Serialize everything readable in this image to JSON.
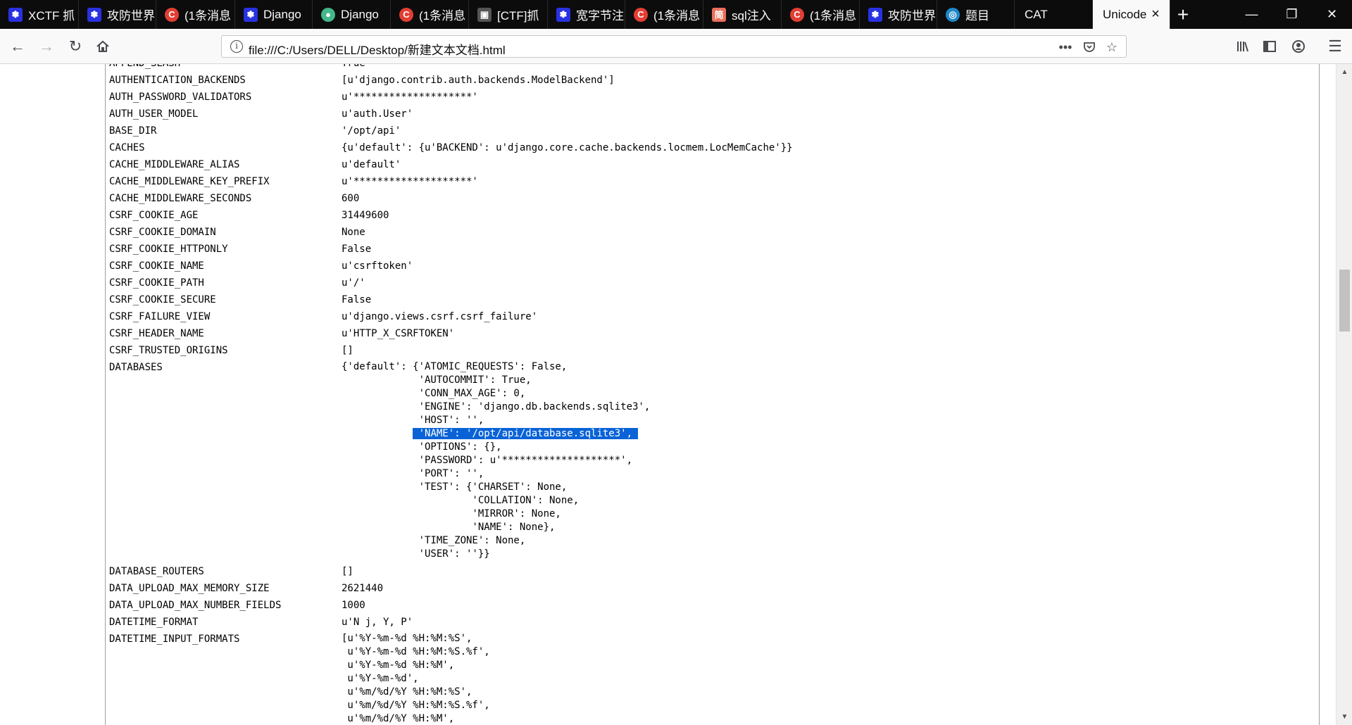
{
  "tabs": [
    {
      "label": "XCTF 抓",
      "icon": "baidu-paw-icon",
      "glyph": "✽",
      "favclass": "fav-baidu"
    },
    {
      "label": "攻防世界",
      "icon": "baidu-paw-icon",
      "glyph": "✽",
      "favclass": "fav-baidu"
    },
    {
      "label": "(1条消息",
      "icon": "csdn-icon",
      "glyph": "C",
      "favclass": "fav-csdn"
    },
    {
      "label": "Django",
      "icon": "baidu-paw-icon",
      "glyph": "✽",
      "favclass": "fav-baidu"
    },
    {
      "label": "Django",
      "icon": "django-icon",
      "glyph": "●",
      "favclass": "fav-django"
    },
    {
      "label": "(1条消息",
      "icon": "csdn-icon",
      "glyph": "C",
      "favclass": "fav-csdn"
    },
    {
      "label": "[CTF]抓",
      "icon": "ctf-site-icon",
      "glyph": "▣",
      "favclass": "fav-ctf"
    },
    {
      "label": "宽字节注",
      "icon": "baidu-paw-icon",
      "glyph": "✽",
      "favclass": "fav-baidu"
    },
    {
      "label": "(1条消息",
      "icon": "csdn-icon",
      "glyph": "C",
      "favclass": "fav-csdn"
    },
    {
      "label": "sql注入",
      "icon": "jianshu-icon",
      "glyph": "简",
      "favclass": "fav-jian"
    },
    {
      "label": "(1条消息",
      "icon": "csdn-icon",
      "glyph": "C",
      "favclass": "fav-csdn"
    },
    {
      "label": "攻防世界",
      "icon": "baidu-paw-icon",
      "glyph": "✽",
      "favclass": "fav-baidu"
    },
    {
      "label": "题目",
      "icon": "site-globe-icon",
      "glyph": "◎",
      "favclass": "fav-blue"
    },
    {
      "label": "CAT",
      "icon": "",
      "glyph": "",
      "favclass": ""
    },
    {
      "label": "Unicode",
      "icon": "",
      "glyph": "",
      "favclass": "",
      "active": true
    }
  ],
  "url": "file:///C:/Users/DELL/Desktop/新建文本文档.html",
  "settings": [
    {
      "key": "APPEND_SLASH",
      "value": "True"
    },
    {
      "key": "AUTHENTICATION_BACKENDS",
      "value": "[u'django.contrib.auth.backends.ModelBackend']"
    },
    {
      "key": "AUTH_PASSWORD_VALIDATORS",
      "value": "u'********************'"
    },
    {
      "key": "AUTH_USER_MODEL",
      "value": "u'auth.User'"
    },
    {
      "key": "BASE_DIR",
      "value": "'/opt/api'"
    },
    {
      "key": "CACHES",
      "value": "{u'default': {u'BACKEND': u'django.core.cache.backends.locmem.LocMemCache'}}"
    },
    {
      "key": "CACHE_MIDDLEWARE_ALIAS",
      "value": "u'default'"
    },
    {
      "key": "CACHE_MIDDLEWARE_KEY_PREFIX",
      "value": "u'********************'"
    },
    {
      "key": "CACHE_MIDDLEWARE_SECONDS",
      "value": "600"
    },
    {
      "key": "CSRF_COOKIE_AGE",
      "value": "31449600"
    },
    {
      "key": "CSRF_COOKIE_DOMAIN",
      "value": "None"
    },
    {
      "key": "CSRF_COOKIE_HTTPONLY",
      "value": "False"
    },
    {
      "key": "CSRF_COOKIE_NAME",
      "value": "u'csrftoken'"
    },
    {
      "key": "CSRF_COOKIE_PATH",
      "value": "u'/'"
    },
    {
      "key": "CSRF_COOKIE_SECURE",
      "value": "False"
    },
    {
      "key": "CSRF_FAILURE_VIEW",
      "value": "u'django.views.csrf.csrf_failure'"
    },
    {
      "key": "CSRF_HEADER_NAME",
      "value": "u'HTTP_X_CSRFTOKEN'"
    },
    {
      "key": "CSRF_TRUSTED_ORIGINS",
      "value": "[]"
    },
    {
      "key": "DATABASES",
      "lines": [
        "{'default': {'ATOMIC_REQUESTS': False,",
        "             'AUTOCOMMIT': True,",
        "             'CONN_MAX_AGE': 0,",
        "             'ENGINE': 'django.db.backends.sqlite3',",
        "             'HOST': '',",
        "             'NAME': '/opt/api/database.sqlite3',",
        "             'OPTIONS': {},",
        "             'PASSWORD': u'********************',",
        "             'PORT': '',",
        "             'TEST': {'CHARSET': None,",
        "                      'COLLATION': None,",
        "                      'MIRROR': None,",
        "                      'NAME': None},",
        "             'TIME_ZONE': None,",
        "             'USER': ''}}"
      ],
      "highlight_line": 5
    },
    {
      "key": "DATABASE_ROUTERS",
      "value": "[]"
    },
    {
      "key": "DATA_UPLOAD_MAX_MEMORY_SIZE",
      "value": "2621440"
    },
    {
      "key": "DATA_UPLOAD_MAX_NUMBER_FIELDS",
      "value": "1000"
    },
    {
      "key": "DATETIME_FORMAT",
      "value": "u'N j, Y, P'"
    },
    {
      "key": "DATETIME_INPUT_FORMATS",
      "lines": [
        "[u'%Y-%m-%d %H:%M:%S',",
        " u'%Y-%m-%d %H:%M:%S.%f',",
        " u'%Y-%m-%d %H:%M',",
        " u'%Y-%m-%d',",
        " u'%m/%d/%Y %H:%M:%S',",
        " u'%m/%d/%Y %H:%M:%S.%f',",
        " u'%m/%d/%Y %H:%M',"
      ]
    }
  ],
  "colors": {
    "tabstrip": "#0c0c0d",
    "selection": "#0a63d6"
  }
}
